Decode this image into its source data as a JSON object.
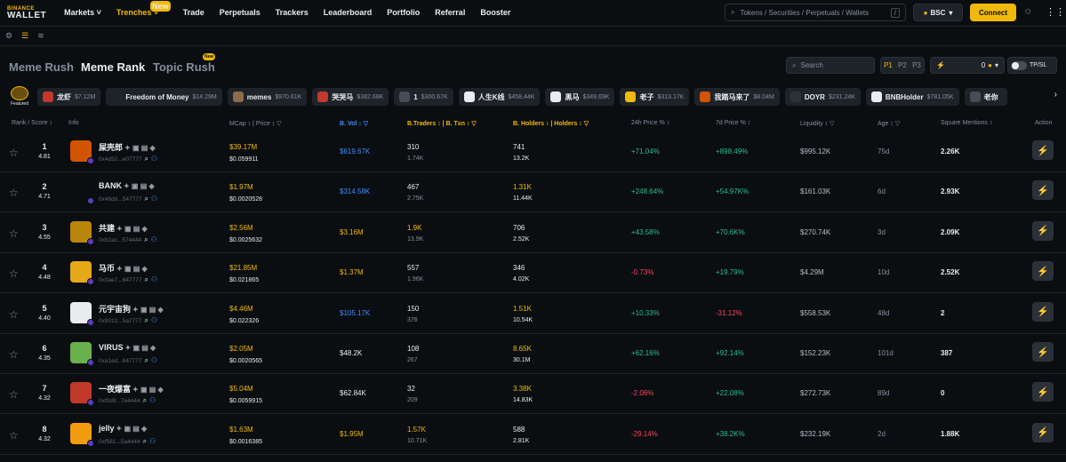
{
  "brand": {
    "line1": "BINANCE",
    "line2": "WALLET"
  },
  "nav": [
    {
      "label": "Markets ˅"
    },
    {
      "label": "Trenches ˅",
      "new": "New"
    },
    {
      "label": "Trade"
    },
    {
      "label": "Perpetuals"
    },
    {
      "label": "Trackers"
    },
    {
      "label": "Leaderboard"
    },
    {
      "label": "Portfolio"
    },
    {
      "label": "Referral"
    },
    {
      "label": "Booster"
    }
  ],
  "top_search": {
    "placeholder": "Tokens / Securities / Perpetuals / Wallets",
    "shortcut": "/"
  },
  "network": "BSC",
  "connect": "Connect",
  "tabs": [
    "Meme Rush",
    "Meme Rank",
    "Topic Rush"
  ],
  "topic_new": "New",
  "search_placeholder": "Search",
  "presets": [
    "P1",
    "P2",
    "P3"
  ],
  "flash_value": "0",
  "tpsl": "TP/SL",
  "featured": "Featured",
  "chips": [
    {
      "name": "龙虾",
      "value": "$7.12M",
      "color": "#c0392b"
    },
    {
      "name": "Freedom of Money",
      "value": "$14.29M",
      "color": "#1e2329"
    },
    {
      "name": "memes",
      "value": "$970.61K",
      "color": "#8e6b4a"
    },
    {
      "name": "哭哭马",
      "value": "$382.68K",
      "color": "#c0392b"
    },
    {
      "name": "1",
      "value": "$300.67K",
      "color": "#474d57"
    },
    {
      "name": "人生K线",
      "value": "$458.44K",
      "color": "#eaecef"
    },
    {
      "name": "黑马",
      "value": "$349.69K",
      "color": "#eaecef"
    },
    {
      "name": "老子",
      "value": "$313.17K",
      "color": "#f0b90b"
    },
    {
      "name": "我踏马来了",
      "value": "$8.04M",
      "color": "#d35400"
    },
    {
      "name": "DOYR",
      "value": "$231.24K",
      "color": "#2b3139"
    },
    {
      "name": "BNBHolder",
      "value": "$781.05K",
      "color": "#eaecef"
    },
    {
      "name": "老你",
      "value": "",
      "color": "#474d57"
    }
  ],
  "headers": {
    "rank": "Rank / Score ↕",
    "info": "Info",
    "mcap": "MCap ↕ | Price ↕ ▽",
    "vol": "B. Vol ↕ ▽",
    "traders": "B.Traders ↕ | B. Txn ↕ ▽",
    "holders": "B. Holders ↕ | Holders ↕ ▽",
    "p24": "24h Price % ↕",
    "p7": "7d Price % ↕",
    "liq": "Liquidity ↕ ▽",
    "age": "Age ↕ ▽",
    "sq": "Square Mentions ↕",
    "action": "Action"
  },
  "rows": [
    {
      "rank": "1",
      "score": "4.81",
      "name": "屎壳郎",
      "addr": "0x4d52...e07777",
      "mcap": "$39.17M",
      "price": "$0.059911",
      "vol": "$619.67K",
      "volc": "blu",
      "tr": "310",
      "txn": "1.74K",
      "trc": "wht",
      "hol": "741",
      "holders": "13.2K",
      "holc": "wht",
      "p24": "+71.04%",
      "p24c": "up",
      "p7": "+898.49%",
      "p7c": "up",
      "liq": "$995.12K",
      "age": "75d",
      "sq": "2.26K",
      "avc": "#d35400"
    },
    {
      "rank": "2",
      "score": "4.71",
      "name": "BANK",
      "addr": "0x46dd...547777",
      "mcap": "$1.97M",
      "price": "$0.0020528",
      "vol": "$314.58K",
      "volc": "blu",
      "tr": "467",
      "txn": "2.75K",
      "trc": "wht",
      "hol": "1.31K",
      "holders": "11.44K",
      "holc": "yel",
      "p24": "+248.64%",
      "p24c": "up",
      "p7": "+54.97K%",
      "p7c": "up",
      "liq": "$161.03K",
      "age": "6d",
      "sq": "2.93K",
      "avc": "#0b0e11"
    },
    {
      "rank": "3",
      "score": "4.55",
      "name": "共建",
      "addr": "0xb2ac...574444",
      "mcap": "$2.56M",
      "price": "$0.0025632",
      "vol": "$3.16M",
      "volc": "yel",
      "tr": "1.9K",
      "txn": "13.9K",
      "trc": "yel",
      "hol": "706",
      "holders": "2.52K",
      "holc": "wht",
      "p24": "+43.58%",
      "p24c": "up",
      "p7": "+70.6K%",
      "p7c": "up",
      "liq": "$270.74K",
      "age": "3d",
      "sq": "2.09K",
      "avc": "#b8860b"
    },
    {
      "rank": "4",
      "score": "4.48",
      "name": "马币",
      "addr": "0x0ae7...647777",
      "mcap": "$21.85M",
      "price": "$0.021865",
      "vol": "$1.37M",
      "volc": "yel",
      "tr": "557",
      "txn": "1.96K",
      "trc": "wht",
      "hol": "346",
      "holders": "4.02K",
      "holc": "wht",
      "p24": "-0.73%",
      "p24c": "dn",
      "p7": "+19.79%",
      "p7c": "up",
      "liq": "$4.29M",
      "age": "10d",
      "sq": "2.52K",
      "avc": "#e6a817"
    },
    {
      "rank": "5",
      "score": "4.40",
      "name": "元宇宙狗",
      "addr": "0x9012...5a7777",
      "mcap": "$4.46M",
      "price": "$0.022326",
      "vol": "$105.17K",
      "volc": "blu",
      "tr": "150",
      "txn": "376",
      "trc": "wht",
      "hol": "1.51K",
      "holders": "10.54K",
      "holc": "yel",
      "p24": "+10.33%",
      "p24c": "up",
      "p7": "-31.12%",
      "p7c": "dn",
      "liq": "$558.53K",
      "age": "48d",
      "sq": "2",
      "avc": "#eaecef"
    },
    {
      "rank": "6",
      "score": "4.35",
      "name": "VIRUS",
      "addr": "0xa1ed...647777",
      "mcap": "$2.05M",
      "price": "$0.0020565",
      "vol": "$48.2K",
      "volc": "wht",
      "tr": "108",
      "txn": "267",
      "trc": "wht",
      "hol": "8.65K",
      "holders": "30.1M",
      "holc": "yel",
      "p24": "+62.16%",
      "p24c": "up",
      "p7": "+92.14%",
      "p7c": "up",
      "liq": "$152.23K",
      "age": "101d",
      "sq": "387",
      "avc": "#6ab04c"
    },
    {
      "rank": "7",
      "score": "4.32",
      "name": "一夜爆富",
      "addr": "0xf0d9...7e4444",
      "mcap": "$5.04M",
      "price": "$0.0059915",
      "vol": "$62.84K",
      "volc": "wht",
      "tr": "32",
      "txn": "209",
      "trc": "wht",
      "hol": "3.38K",
      "holders": "14.83K",
      "holc": "yel",
      "p24": "-2.06%",
      "p24c": "dn",
      "p7": "+22.08%",
      "p7c": "up",
      "liq": "$272.73K",
      "age": "89d",
      "sq": "0",
      "avc": "#c0392b"
    },
    {
      "rank": "8",
      "score": "4.32",
      "name": "jelly",
      "addr": "0xf581...5a4444",
      "mcap": "$1.63M",
      "price": "$0.0016385",
      "vol": "$1.95M",
      "volc": "yel",
      "tr": "1.57K",
      "txn": "10.71K",
      "trc": "yel",
      "hol": "588",
      "holders": "2.81K",
      "holc": "wht",
      "p24": "-29.14%",
      "p24c": "dn",
      "p7": "+38.2K%",
      "p7c": "up",
      "liq": "$232.19K",
      "age": "2d",
      "sq": "1.88K",
      "avc": "#f39c12"
    }
  ]
}
